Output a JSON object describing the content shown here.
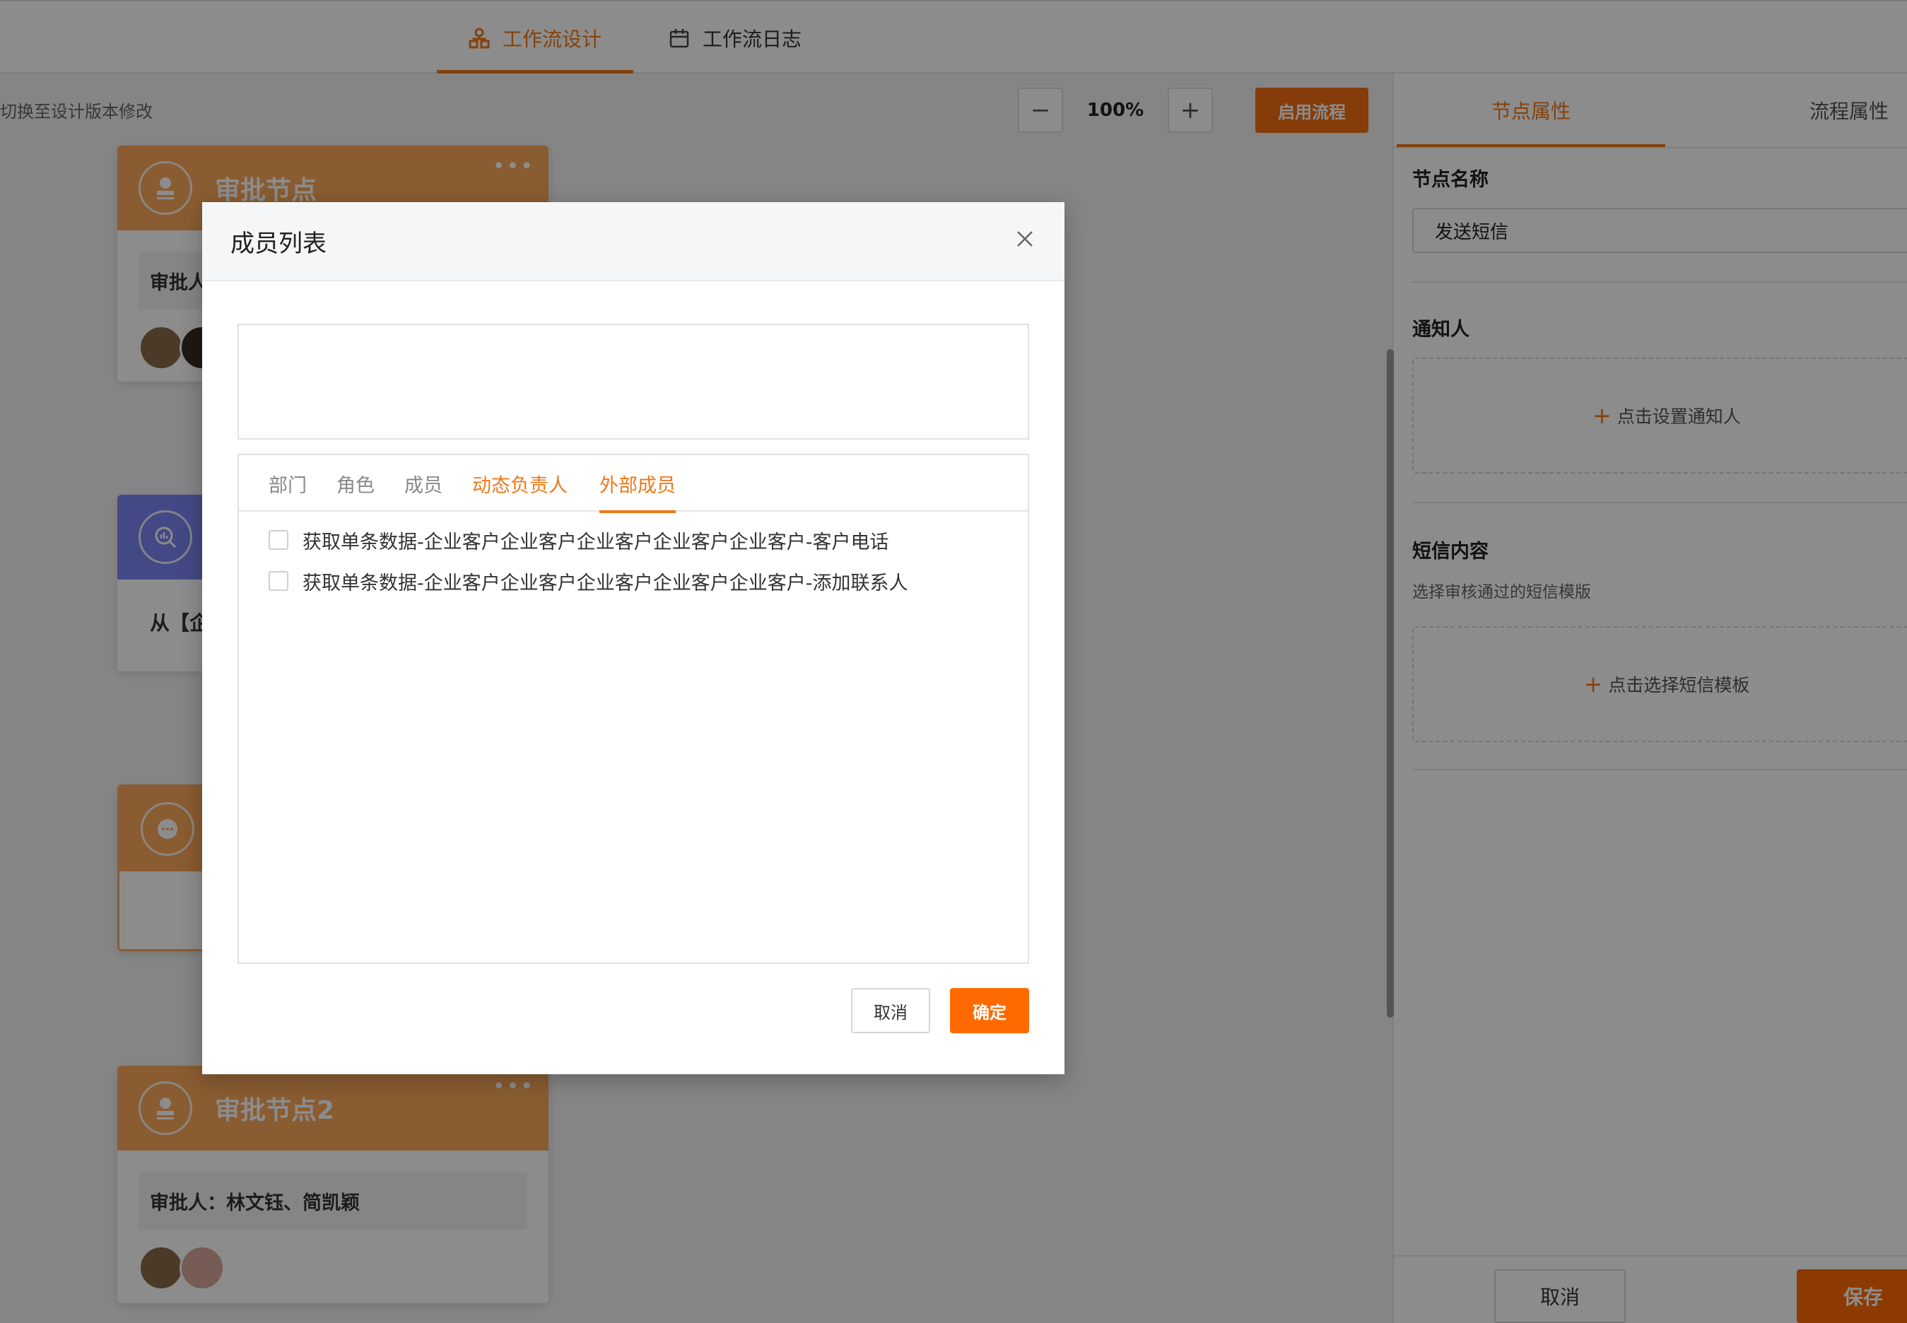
{
  "top_tabs": [
    {
      "label": "工作流设计",
      "icon": "workflow-icon",
      "active": true
    },
    {
      "label": "工作流日志",
      "icon": "calendar-icon",
      "active": false
    }
  ],
  "toolbar": {
    "hint": "切换至设计版本修改",
    "zoom": "100%",
    "enable_label": "启用流程"
  },
  "cards": [
    {
      "title": "审批节点",
      "icon": "stamp-icon",
      "field": "审批人",
      "color": "#fba859"
    },
    {
      "title": "",
      "icon": "search-data-icon",
      "field": "从【企",
      "color": "#7a86f0"
    },
    {
      "title": "",
      "icon": "message-icon",
      "field": "",
      "color": "#fba859"
    },
    {
      "title": "审批节点2",
      "icon": "stamp-icon",
      "field": "审批人：林文钰、简凯颖",
      "color": "#fba859"
    }
  ],
  "right_panel": {
    "tabs": [
      {
        "label": "节点属性",
        "active": true
      },
      {
        "label": "流程属性",
        "active": false
      }
    ],
    "node_name_label": "节点名称",
    "node_name_value": "发送短信",
    "notifier_label": "通知人",
    "notifier_action": "点击设置通知人",
    "sms_label": "短信内容",
    "sms_hint": "选择审核通过的短信模版",
    "sms_action": "点击选择短信模板",
    "cancel_label": "取消",
    "save_label": "保存"
  },
  "modal": {
    "title": "成员列表",
    "tabs": [
      {
        "label": "部门",
        "highlight": false
      },
      {
        "label": "角色",
        "highlight": false
      },
      {
        "label": "成员",
        "highlight": false
      },
      {
        "label": "动态负责人",
        "highlight": true
      },
      {
        "label": "外部成员",
        "highlight": true,
        "active": true
      }
    ],
    "items": [
      {
        "label": "获取单条数据-企业客户企业客户企业客户企业客户企业客户-客户电话",
        "checked": false
      },
      {
        "label": "获取单条数据-企业客户企业客户企业客户企业客户企业客户-添加联系人",
        "checked": false
      }
    ],
    "cancel_label": "取消",
    "confirm_label": "确定"
  },
  "colors": {
    "accent": "#f07818",
    "primary_button": "#ff6a00"
  }
}
